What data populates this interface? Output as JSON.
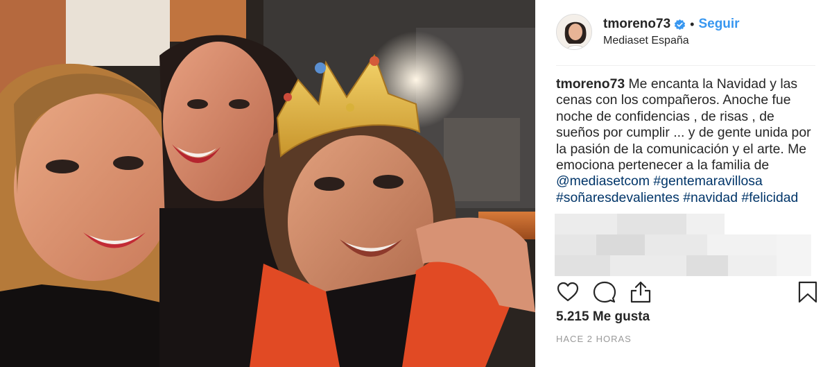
{
  "post": {
    "image_alt_icon": "photo-selfie",
    "header": {
      "username": "tmoreno73",
      "verified_icon": "verified-badge-icon",
      "separator": "•",
      "follow_label": "Seguir",
      "location": "Mediaset España"
    },
    "caption": {
      "username": "tmoreno73",
      "text_1": " Me encanta la Navidad y las cenas con los compañeros. Anoche fue noche de confidencias , de risas , de sueños por cumplir ... y de gente unida por la pasión de la comunicación y el arte. Me emociona pertenecer a la familia de ",
      "tag_1": "@mediasetcom",
      "sp_1": " ",
      "tag_2": "#gentemaravillosa",
      "sp_2": " ",
      "tag_3": "#soñaresdevalientes",
      "sp_3": " ",
      "tag_4": "#navidad",
      "sp_4": " ",
      "tag_5": "#felicidad"
    },
    "actions": {
      "like_icon": "heart-icon",
      "comment_icon": "comment-icon",
      "share_icon": "share-icon",
      "save_icon": "bookmark-icon"
    },
    "likes_label": "5.215 Me gusta",
    "timestamp": "HACE 2 HORAS"
  },
  "colors": {
    "link": "#003569",
    "follow": "#3897f0",
    "verified": "#3897f0",
    "text": "#262626",
    "muted": "#999999"
  }
}
